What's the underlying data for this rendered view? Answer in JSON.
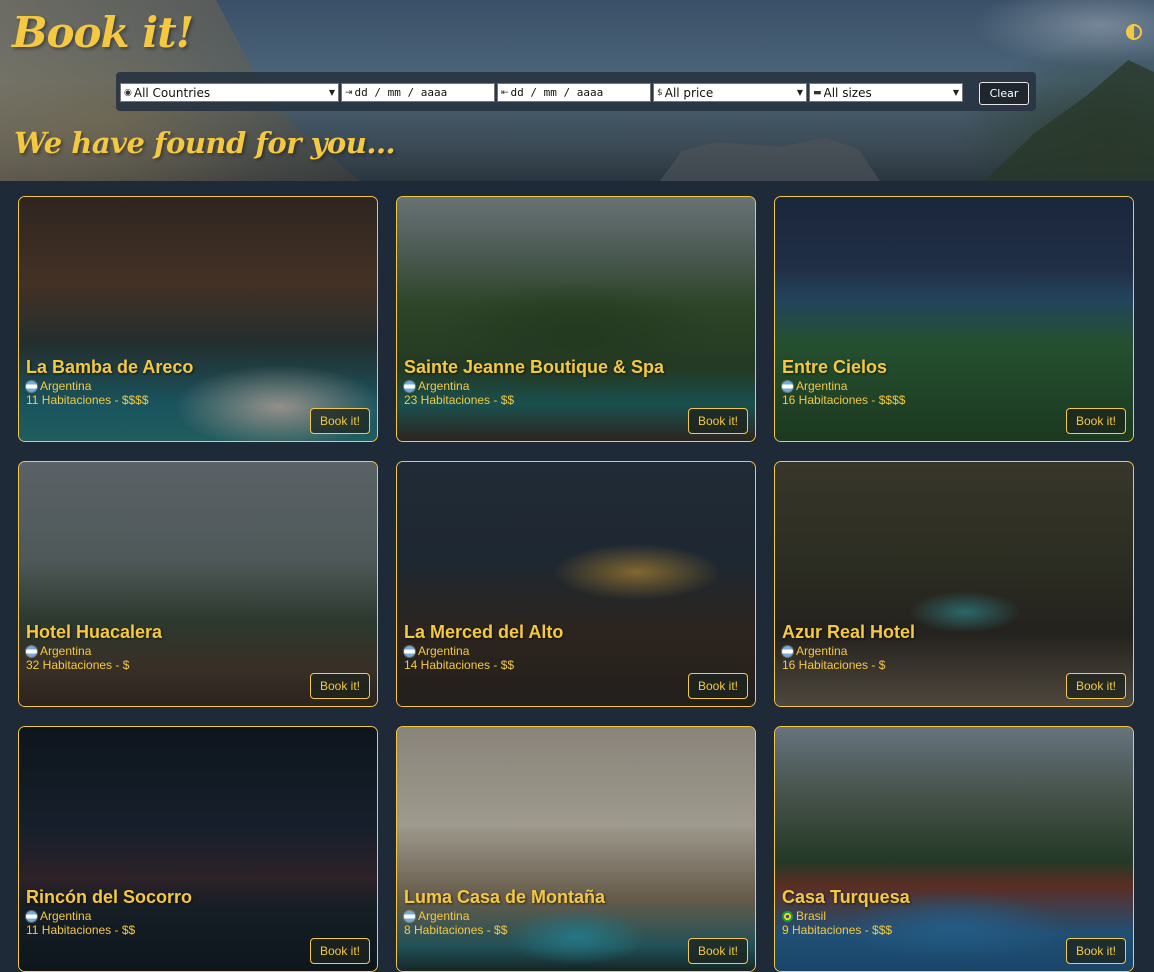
{
  "header": {
    "brand": "Book it!",
    "subtitle": "We have found for you..."
  },
  "filters": {
    "country": "All Countries",
    "checkin": "dd / mm / aaaa",
    "checkout": "dd / mm / aaaa",
    "price": "All price",
    "size": "All sizes",
    "clear_label": "Clear"
  },
  "colors": {
    "accent": "#f5c842",
    "background": "#1e2a38"
  },
  "hotels": [
    {
      "name": "La Bamba de Areco",
      "country": "Argentina",
      "rooms": "11 Habitaciones - $$$$",
      "flag": "argentina-flag-icon",
      "book": "Book it!"
    },
    {
      "name": "Sainte Jeanne Boutique & Spa",
      "country": "Argentina",
      "rooms": "23 Habitaciones - $$",
      "flag": "argentina-flag-icon",
      "book": "Book it!"
    },
    {
      "name": "Entre Cielos",
      "country": "Argentina",
      "rooms": "16 Habitaciones - $$$$",
      "flag": "argentina-flag-icon",
      "book": "Book it!"
    },
    {
      "name": "Hotel Huacalera",
      "country": "Argentina",
      "rooms": "32 Habitaciones - $",
      "flag": "argentina-flag-icon",
      "book": "Book it!"
    },
    {
      "name": "La Merced del Alto",
      "country": "Argentina",
      "rooms": "14 Habitaciones - $$",
      "flag": "argentina-flag-icon",
      "book": "Book it!"
    },
    {
      "name": "Azur Real Hotel",
      "country": "Argentina",
      "rooms": "16 Habitaciones - $",
      "flag": "argentina-flag-icon",
      "book": "Book it!"
    },
    {
      "name": "Rincón del Socorro",
      "country": "Argentina",
      "rooms": "11 Habitaciones - $$",
      "flag": "argentina-flag-icon",
      "book": "Book it!"
    },
    {
      "name": "Luma Casa de Montaña",
      "country": "Argentina",
      "rooms": "8 Habitaciones - $$",
      "flag": "argentina-flag-icon",
      "book": "Book it!"
    },
    {
      "name": "Casa Turquesa",
      "country": "Brasil",
      "rooms": "9 Habitaciones - $$$",
      "flag": "brazil-flag-icon",
      "book": "Book it!"
    }
  ]
}
